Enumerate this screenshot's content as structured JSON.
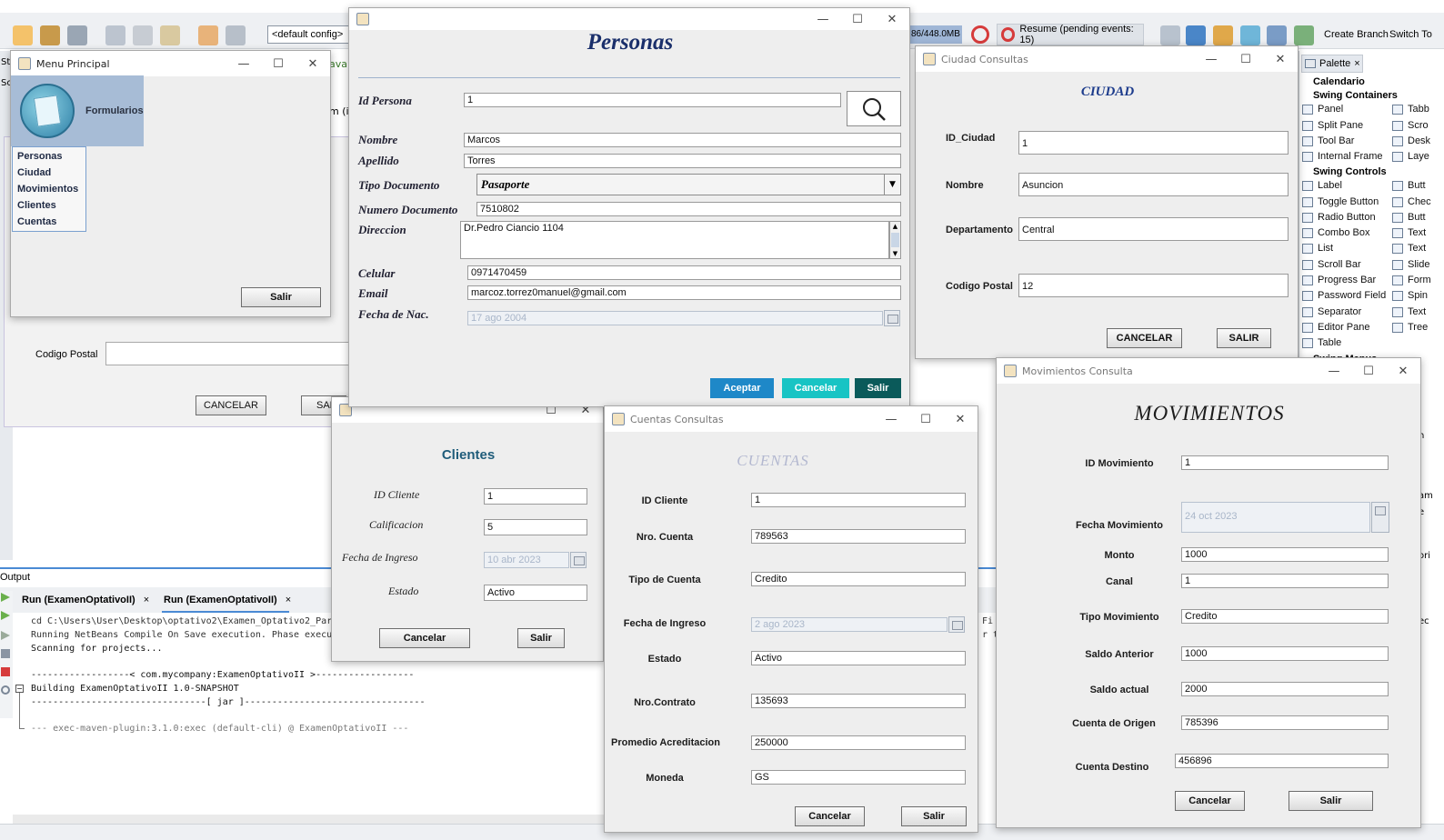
{
  "ide": {
    "config_combo": "<default config>",
    "memory": "86/448.0MB",
    "resume": "Resume (pending events: 15)",
    "create_branch": "Create Branch",
    "switch_to": "Switch To",
    "left_tab": "St",
    "left_tab2": "Sc",
    "java_tab": "ava",
    "bg_codigo_postal": "Codigo Postal",
    "bg_cancelar": "CANCELAR",
    "bg_salir": "SAL",
    "right_edge1": "am",
    "right_edge2": "e",
    "right_edge3": "ori",
    "right_edge4": "ec",
    "right_edge5": "n",
    "mid_edge": "m (i"
  },
  "palette": {
    "tab": "Palette",
    "calendario": "Calendario",
    "containers_header": "Swing Containers",
    "containers": [
      "Panel",
      "Split Pane",
      "Tool Bar",
      "Internal Frame"
    ],
    "containers_right": [
      "Tabb",
      "Scro",
      "Desk",
      "Laye"
    ],
    "controls_header": "Swing Controls",
    "controls": [
      "Label",
      "Toggle Button",
      "Radio Button",
      "Combo Box",
      "List",
      "Scroll Bar",
      "Progress Bar",
      "Password Field",
      "Separator",
      "Editor Pane",
      "Table"
    ],
    "controls_right": [
      "Butt",
      "Chec",
      "Butt",
      "Text",
      "Text",
      "Slide",
      "Form",
      "Spin",
      "Text",
      "Tree"
    ],
    "menus_header": "Swing Menus"
  },
  "output": {
    "title": "Output",
    "tabs": [
      "Run (ExamenOptativoII)",
      "Run (ExamenOptativoII)"
    ],
    "lines": [
      "cd C:\\Users\\User\\Desktop\\optativo2\\Examen_Optativo2_Par",
      "Running NetBeans Compile On Save execution. Phase execu",
      "Scanning for projects...",
      "",
      "------------------< com.mycompany:ExamenOptativoII >------------------",
      "Building ExamenOptativoII 1.0-SNAPSHOT",
      "--------------------------------[ jar ]---------------------------------",
      "",
      "--- exec-maven-plugin:3.1.0:exec (default-cli) @ ExamenOptativoII ---"
    ],
    "right_frag1": "Fi",
    "right_frag2": "r th"
  },
  "menu_principal": {
    "title": "Menu Principal",
    "formularios": "Formularios",
    "items": [
      "Personas",
      "Ciudad",
      "Movimientos",
      "Clientes",
      "Cuentas"
    ],
    "salir": "Salir"
  },
  "personas": {
    "heading": "Personas",
    "labels": {
      "id": "Id Persona",
      "nombre": "Nombre",
      "apellido": "Apellido",
      "tipo_doc": "Tipo Documento",
      "num_doc": "Numero Documento",
      "direccion": "Direccion",
      "celular": "Celular",
      "email": "Email",
      "fecha_nac": "Fecha de Nac."
    },
    "values": {
      "id": "1",
      "nombre": "Marcos",
      "apellido": "Torres",
      "tipo_doc": "Pasaporte",
      "num_doc": "7510802",
      "direccion": "Dr.Pedro Ciancio 1104",
      "celular": "0971470459",
      "email": "marcoz.torrez0manuel@gmail.com",
      "fecha_nac": "17 ago 2004"
    },
    "aceptar": "Aceptar",
    "cancelar": "Cancelar",
    "salir": "Salir",
    "colors": {
      "aceptar": "#1e88c8",
      "cancelar": "#18c4c4",
      "salir": "#0a5a5a"
    }
  },
  "ciudad": {
    "title": "Ciudad Consultas",
    "heading": "CIUDAD",
    "labels": {
      "id": "ID_Ciudad",
      "nombre": "Nombre",
      "departamento": "Departamento",
      "codigo_postal": "Codigo Postal"
    },
    "values": {
      "id": "1",
      "nombre": "Asuncion",
      "departamento": "Central",
      "codigo_postal": "12"
    },
    "cancelar": "CANCELAR",
    "salir": "SALIR"
  },
  "clientes": {
    "heading": "Clientes",
    "labels": {
      "id": "ID Cliente",
      "calificacion": "Calificacion",
      "fecha_ingreso": "Fecha de Ingreso",
      "estado": "Estado"
    },
    "values": {
      "id": "1",
      "calificacion": "5",
      "fecha_ingreso": "10 abr 2023",
      "estado": "Activo"
    },
    "cancelar": "Cancelar",
    "salir": "Salir"
  },
  "cuentas": {
    "title": "Cuentas Consultas",
    "heading": "CUENTAS",
    "labels": {
      "id_cliente": "ID Cliente",
      "nro_cuenta": "Nro. Cuenta",
      "tipo_cuenta": "Tipo de Cuenta",
      "fecha_ingreso": "Fecha de Ingreso",
      "estado": "Estado",
      "nro_contrato": "Nro.Contrato",
      "promedio": "Promedio Acreditacion",
      "moneda": "Moneda"
    },
    "values": {
      "id_cliente": "1",
      "nro_cuenta": "789563",
      "tipo_cuenta": "Credito",
      "fecha_ingreso": "2 ago 2023",
      "estado": "Activo",
      "nro_contrato": "135693",
      "promedio": "250000",
      "moneda": "GS"
    },
    "cancelar": "Cancelar",
    "salir": "Salir"
  },
  "movimientos": {
    "title": "Movimientos Consulta",
    "heading": "MOVIMIENTOS",
    "labels": {
      "id": "ID Movimiento",
      "fecha": "Fecha Movimiento",
      "monto": "Monto",
      "canal": "Canal",
      "tipo": "Tipo Movimiento",
      "saldo_anterior": "Saldo Anterior",
      "saldo_actual": "Saldo actual",
      "cuenta_origen": "Cuenta de Origen",
      "cuenta_destino": "Cuenta Destino"
    },
    "values": {
      "id": "1",
      "fecha": "24 oct 2023",
      "monto": "1000",
      "canal": "1",
      "tipo": "Credito",
      "saldo_anterior": "1000",
      "saldo_actual": "2000",
      "cuenta_origen": "785396",
      "cuenta_destino": "456896"
    },
    "cancelar": "Cancelar",
    "salir": "Salir"
  }
}
